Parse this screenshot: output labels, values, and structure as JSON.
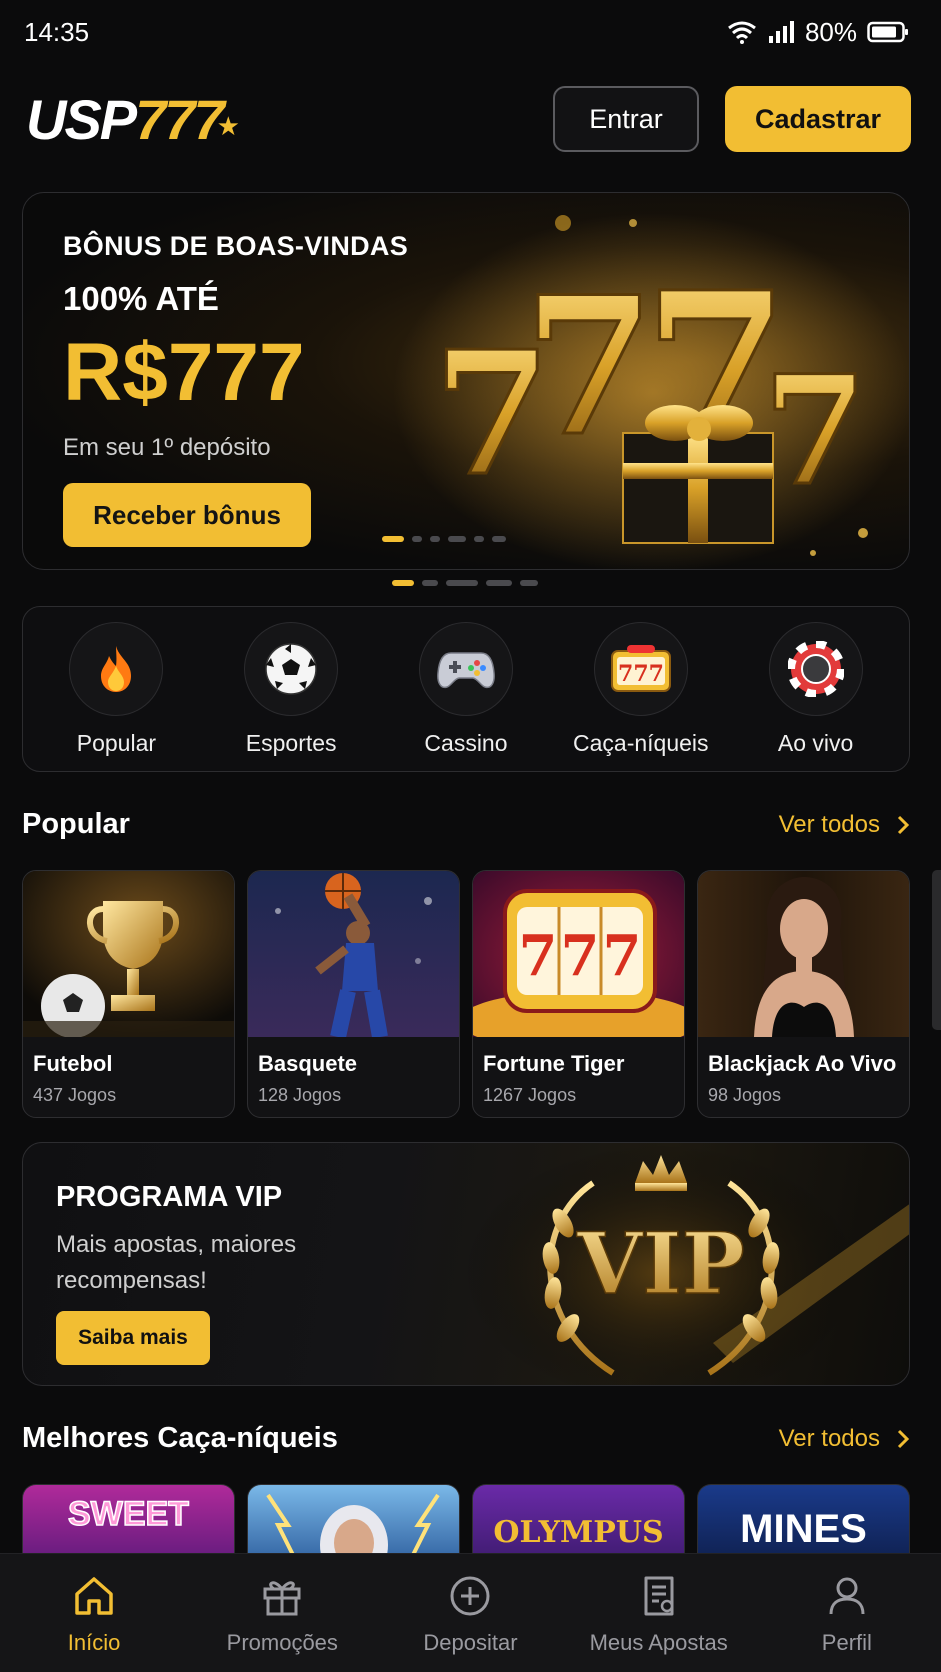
{
  "status_bar": {
    "time": "14:35",
    "battery": "80%"
  },
  "header": {
    "logo_white": "USP",
    "logo_gold": "777",
    "login_label": "Entrar",
    "register_label": "Cadastrar"
  },
  "hero": {
    "kicker": "BÔNUS DE BOAS-VINDAS",
    "line2": "100% ATÉ",
    "amount": "R$777",
    "subtitle": "Em seu 1º depósito",
    "cta_label": "Receber bônus"
  },
  "categories": [
    {
      "label": "Popular",
      "icon": "fire-icon"
    },
    {
      "label": "Esportes",
      "icon": "soccer-ball-icon"
    },
    {
      "label": "Cassino",
      "icon": "gamepad-icon"
    },
    {
      "label": "Caça-níqueis",
      "icon": "slot-777-icon"
    },
    {
      "label": "Ao vivo",
      "icon": "casino-chip-icon"
    }
  ],
  "popular": {
    "title": "Popular",
    "see_all": "Ver todos",
    "items": [
      {
        "title": "Futebol",
        "count": "437 Jogos"
      },
      {
        "title": "Basquete",
        "count": "128 Jogos"
      },
      {
        "title": "Fortune Tiger",
        "count": "1267 Jogos"
      },
      {
        "title": "Blackjack Ao Vivo",
        "count": "98 Jogos"
      }
    ]
  },
  "vip": {
    "title": "PROGRAMA VIP",
    "subtitle": "Mais apostas, maiores recompensas!",
    "cta_label": "Saiba mais",
    "badge_text": "VIP"
  },
  "slots": {
    "title": "Melhores Caça-níqueis",
    "see_all": "Ver todos",
    "items": [
      {
        "art_text": "SWEET"
      },
      {
        "art_text": ""
      },
      {
        "art_text": "OLYMPUS"
      },
      {
        "art_text": "MINES"
      }
    ]
  },
  "bottom_nav": [
    {
      "label": "Início",
      "icon": "home-icon",
      "active": true
    },
    {
      "label": "Promoções",
      "icon": "gift-icon",
      "active": false
    },
    {
      "label": "Depositar",
      "icon": "plus-circle-icon",
      "active": false
    },
    {
      "label": "Meus Apostas",
      "icon": "receipt-icon",
      "active": false
    },
    {
      "label": "Perfil",
      "icon": "user-icon",
      "active": false
    }
  ],
  "colors": {
    "accent": "#f2be33",
    "background": "#0b0b0c",
    "card": "#121214"
  }
}
